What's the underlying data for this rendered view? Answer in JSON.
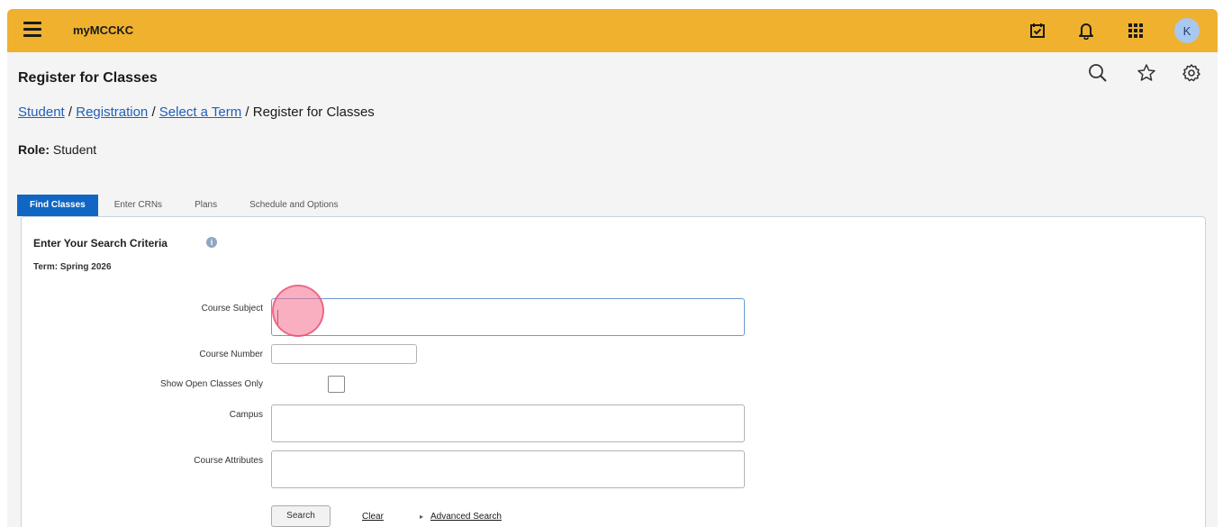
{
  "topbar": {
    "app_title": "myMCCKC",
    "avatar_initial": "K",
    "icons": [
      "menu-icon",
      "calendar-check-icon",
      "bell-icon",
      "apps-grid-icon",
      "avatar"
    ]
  },
  "header": {
    "page_title": "Register for Classes",
    "breadcrumb": {
      "items": [
        {
          "label": "Student",
          "link": true
        },
        {
          "label": "Registration",
          "link": true
        },
        {
          "label": "Select a Term",
          "link": true
        },
        {
          "label": "Register for Classes",
          "link": false
        }
      ],
      "separator": " / "
    },
    "role_label": "Role:",
    "role_value": "Student",
    "icons": [
      "search-icon",
      "star-icon",
      "gear-icon"
    ]
  },
  "tabs": [
    {
      "label": "Find Classes",
      "active": true
    },
    {
      "label": "Enter CRNs",
      "active": false
    },
    {
      "label": "Plans",
      "active": false
    },
    {
      "label": "Schedule and Options",
      "active": false
    }
  ],
  "search": {
    "title": "Enter Your Search Criteria",
    "term": "Term: Spring 2026",
    "fields": {
      "course_subject_label": "Course Subject",
      "course_number_label": "Course Number",
      "open_only_label": "Show Open Classes Only",
      "campus_label": "Campus",
      "attributes_label": "Course Attributes"
    },
    "open_only_checked": false,
    "search_button": "Search",
    "clear_link": "Clear",
    "advanced_link": "Advanced Search"
  },
  "colors": {
    "topbar": "#efb12e",
    "tab_active": "#1166c4",
    "link": "#1f5fb8",
    "click_marker": "#f56e8c"
  }
}
